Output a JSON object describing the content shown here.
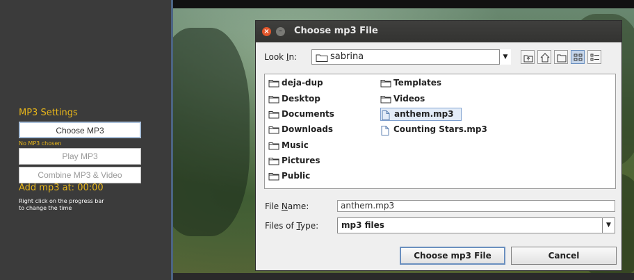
{
  "left_panel": {
    "section_title": "MP3 Settings",
    "choose_button": "Choose MP3",
    "status": "No MP3 chosen",
    "play_button": "Play MP3",
    "combine_button": "Combine MP3 & Video",
    "add_at_label": "Add mp3 at: 00:00",
    "hint_line1": "Right click on the progress bar",
    "hint_line2": "to change the time"
  },
  "dialog": {
    "title": "Choose mp3 File",
    "look_in_label": "Look In:",
    "look_in_value": "sabrina",
    "files": [
      {
        "name": "deja-dup",
        "type": "folder"
      },
      {
        "name": "Desktop",
        "type": "folder"
      },
      {
        "name": "Documents",
        "type": "folder"
      },
      {
        "name": "Downloads",
        "type": "folder"
      },
      {
        "name": "Music",
        "type": "folder"
      },
      {
        "name": "Pictures",
        "type": "folder"
      },
      {
        "name": "Public",
        "type": "folder"
      },
      {
        "name": "Templates",
        "type": "folder"
      },
      {
        "name": "Videos",
        "type": "folder"
      },
      {
        "name": "anthem.mp3",
        "type": "file",
        "selected": true
      },
      {
        "name": "Counting Stars.mp3",
        "type": "file"
      }
    ],
    "file_name_label": "File Name:",
    "file_name_value": "anthem.mp3",
    "files_of_type_label": "Files of Type:",
    "files_of_type_value": "mp3 files",
    "choose_button": "Choose mp3 File",
    "cancel_button": "Cancel"
  },
  "colors": {
    "accent_yellow": "#e8b61a",
    "panel_bg": "#3b3b3b",
    "titlebar_bg": "#3a3a38",
    "close_red": "#e2562b",
    "selection_blue": "#7fa0cf"
  },
  "icons": [
    "close-icon",
    "minimize-icon",
    "folder-icon",
    "file-icon",
    "up-folder-icon",
    "home-icon",
    "new-folder-icon",
    "list-view-icon",
    "details-view-icon",
    "chevron-down-icon"
  ]
}
